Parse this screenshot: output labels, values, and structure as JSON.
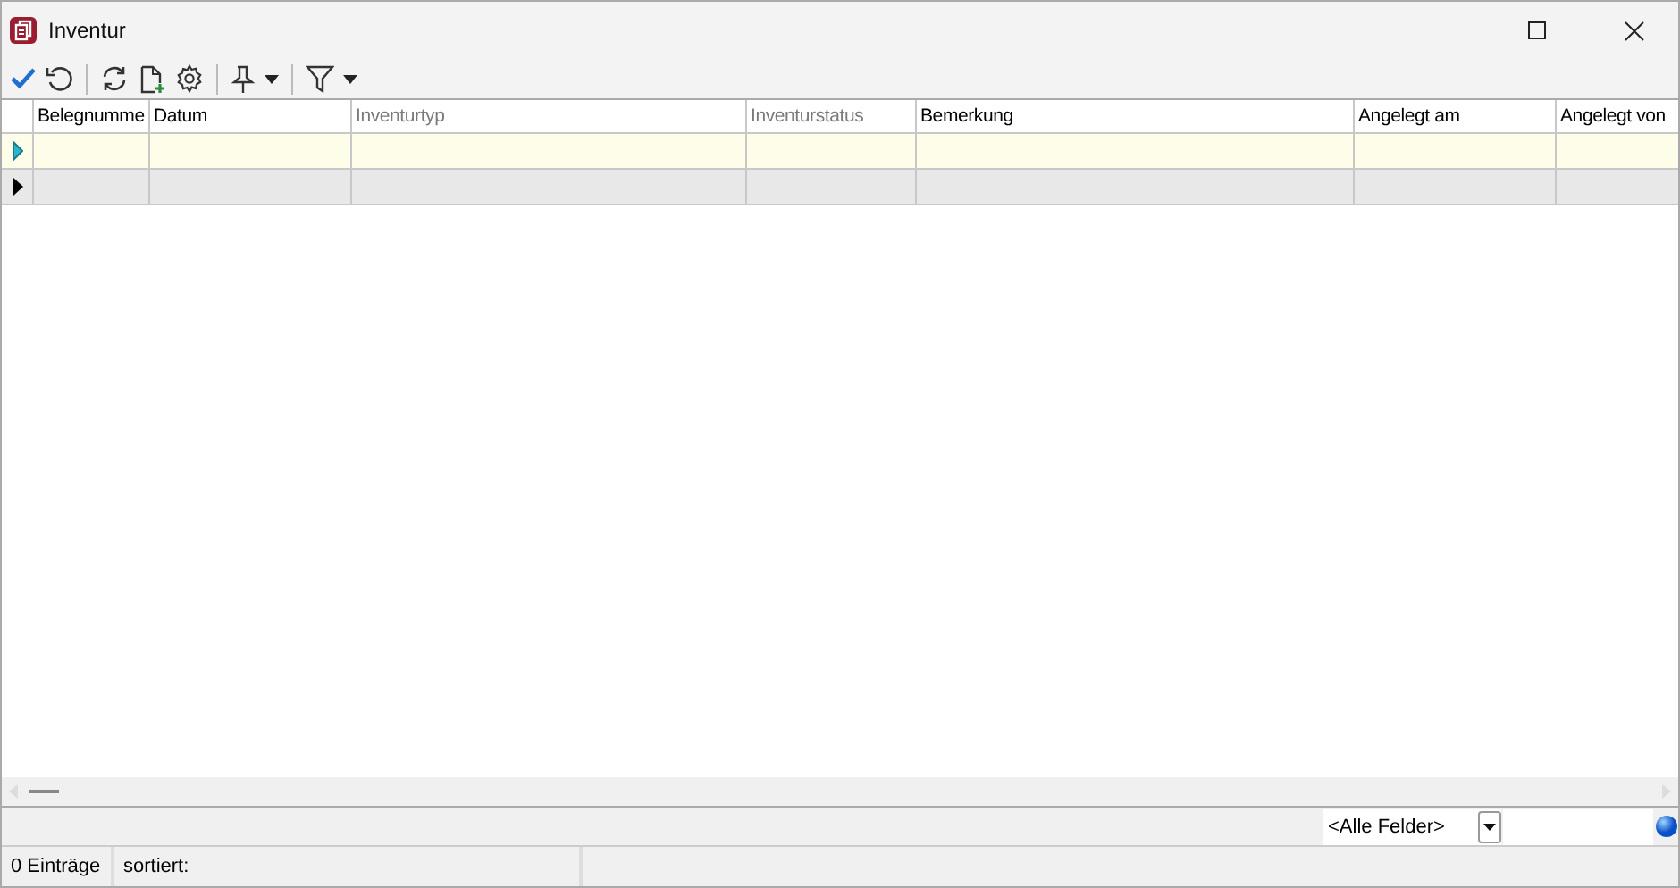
{
  "window": {
    "title": "Inventur"
  },
  "table": {
    "columns": [
      {
        "label": "Belegnumme",
        "muted": false
      },
      {
        "label": "Datum",
        "muted": false
      },
      {
        "label": "Inventurtyp",
        "muted": true
      },
      {
        "label": "Inventurstatus",
        "muted": true
      },
      {
        "label": "Bemerkung",
        "muted": false
      },
      {
        "label": "Angelegt am",
        "muted": false
      },
      {
        "label": "Angelegt von",
        "muted": false
      }
    ],
    "rows": [
      {
        "selected": true
      },
      {
        "selected": false
      }
    ]
  },
  "search": {
    "field_selector": "<Alle Felder>"
  },
  "status_bar": {
    "count": "0 Einträge",
    "sort": "sortiert:"
  }
}
